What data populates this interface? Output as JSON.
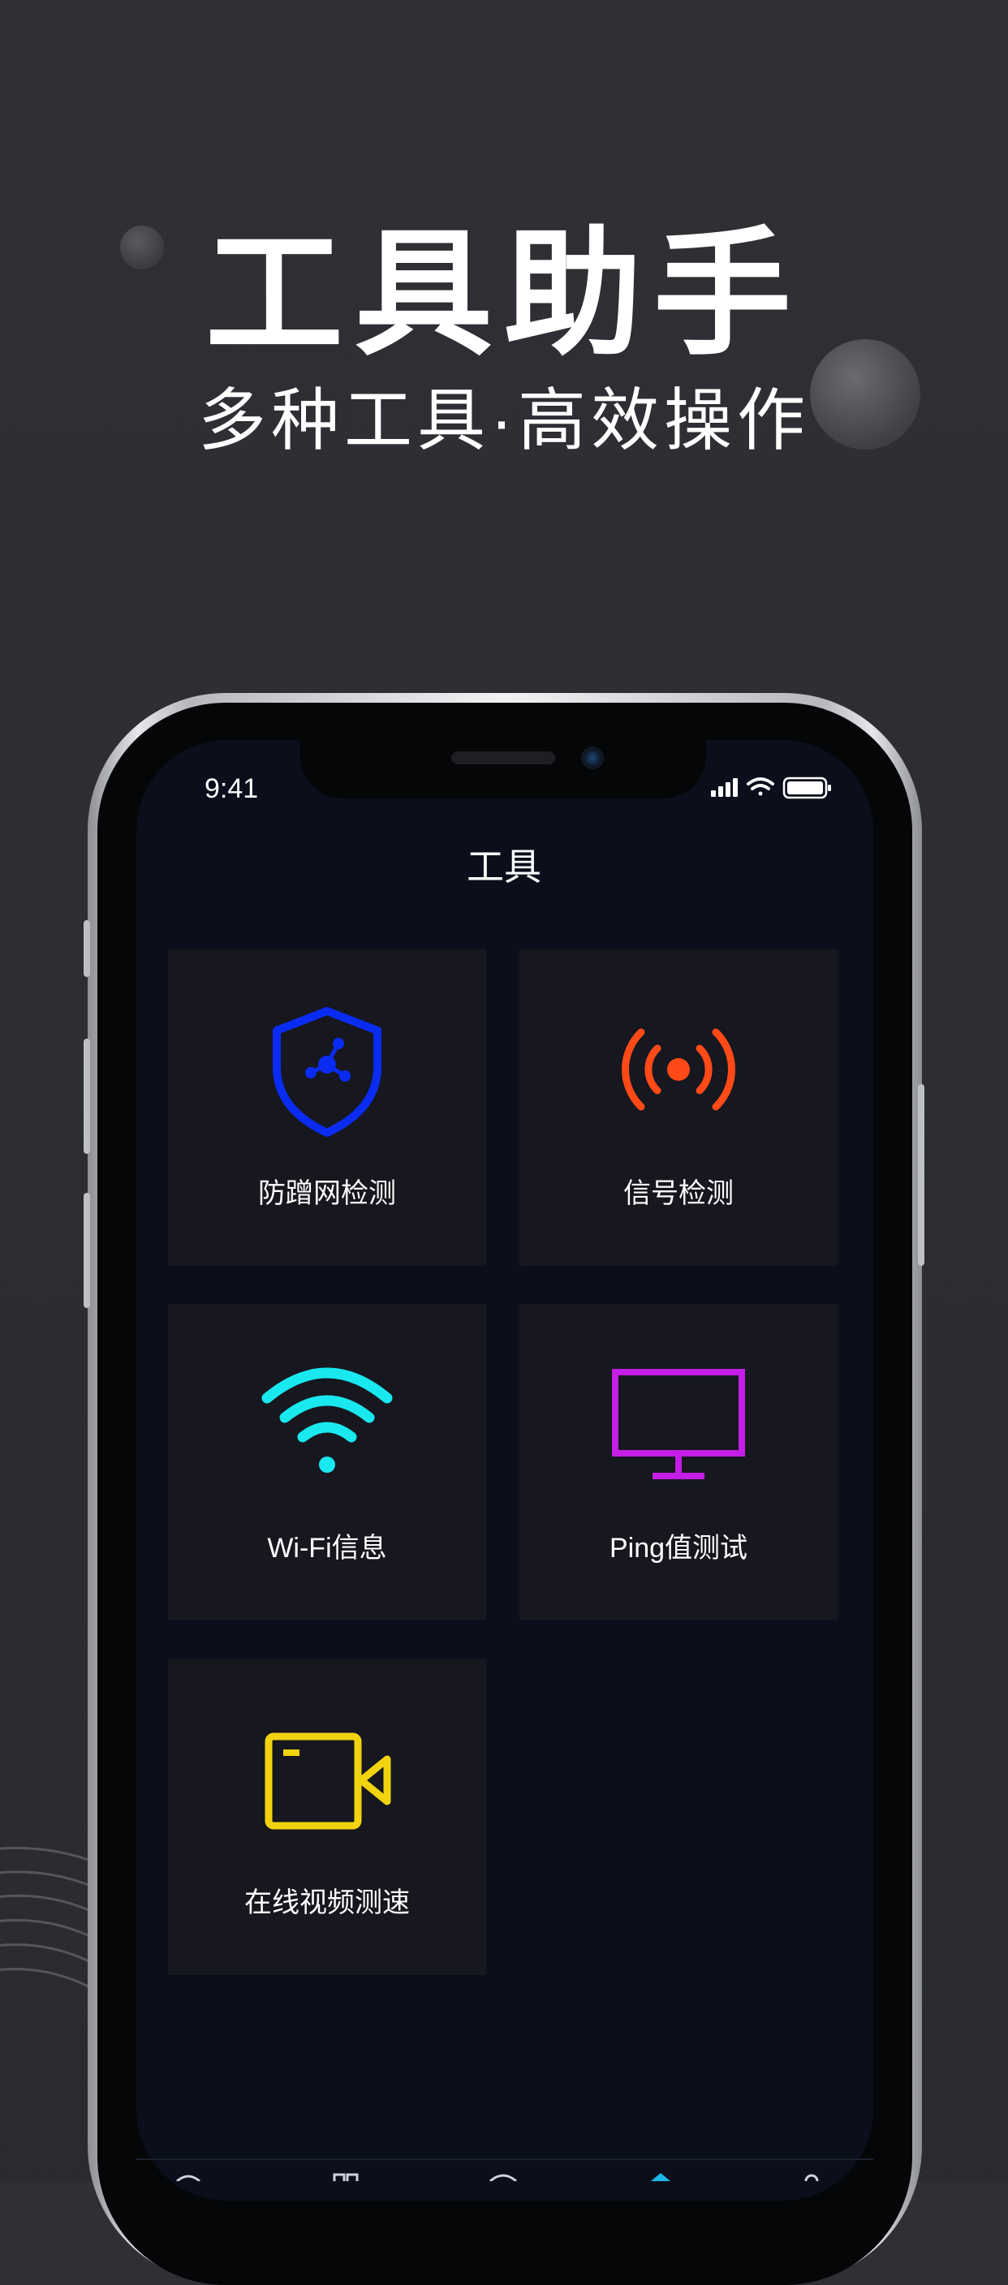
{
  "promo": {
    "title": "工具助手",
    "subtitle": "多种工具·高效操作"
  },
  "status_bar": {
    "time": "9:41"
  },
  "screen": {
    "title": "工具"
  },
  "tools": [
    {
      "label": "防蹭网检测",
      "icon": "shield-network-icon",
      "color": "#0a2cf2"
    },
    {
      "label": "信号检测",
      "icon": "signal-broadcast-icon",
      "color": "#ff4a17"
    },
    {
      "label": "Wi-Fi信息",
      "icon": "wifi-icon",
      "color": "#19e8ee"
    },
    {
      "label": "Ping值测试",
      "icon": "monitor-icon",
      "color": "#c51ee6"
    },
    {
      "label": "在线视频测速",
      "icon": "video-camera-icon",
      "color": "#f2d30f"
    }
  ]
}
